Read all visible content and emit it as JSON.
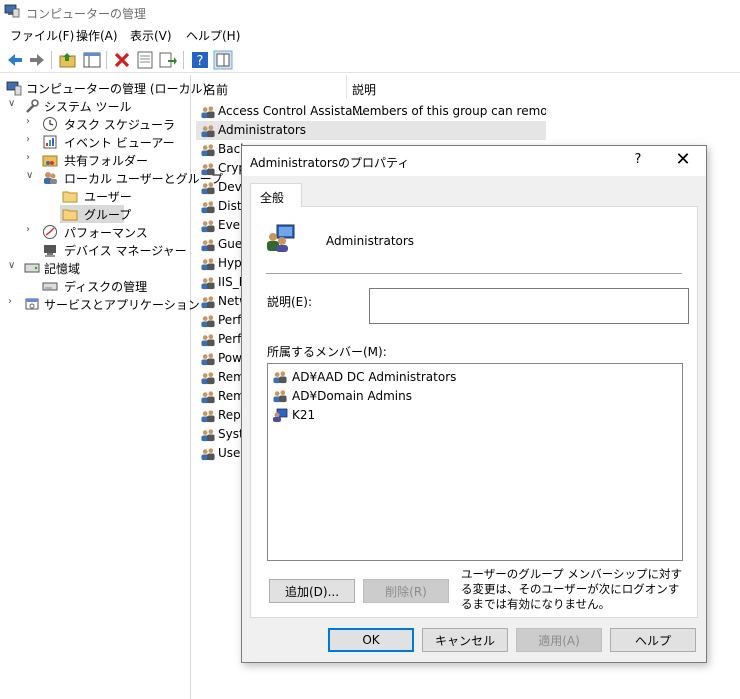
{
  "window": {
    "title": "コンピューターの管理"
  },
  "menu": [
    "ファイル(F)",
    "操作(A)",
    "表示(V)",
    "ヘルプ(H)"
  ],
  "toolbar": {
    "icons": [
      "back-icon",
      "forward-icon",
      "up-folder-icon",
      "show-tree-icon",
      "delete-icon",
      "properties-icon",
      "export-icon",
      "help-icon",
      "action-pane-icon"
    ]
  },
  "tree": {
    "root": "コンピューターの管理 (ローカル)",
    "system_tools": "システム ツール",
    "task_scheduler": "タスク スケジューラ",
    "event_viewer": "イベント ビューアー",
    "shared_folders": "共有フォルダー",
    "local_users_groups": "ローカル ユーザーとグループ",
    "users": "ユーザー",
    "groups": "グループ",
    "performance": "パフォーマンス",
    "device_manager": "デバイス マネージャー",
    "storage": "記憶域",
    "disk_management": "ディスクの管理",
    "services_apps": "サービスとアプリケーション"
  },
  "list": {
    "col_name": "名前",
    "col_desc": "説明",
    "rows": [
      {
        "name": "Access Control Assista...",
        "desc": "Members of this group can remot..."
      },
      {
        "name": "Administrators",
        "desc": ""
      },
      {
        "name": "Back",
        "desc": ""
      },
      {
        "name": "Cryp",
        "desc": ""
      },
      {
        "name": "Devi",
        "desc": ""
      },
      {
        "name": "Distr",
        "desc": ""
      },
      {
        "name": "Even",
        "desc": ""
      },
      {
        "name": "Gues",
        "desc": ""
      },
      {
        "name": "Hypo",
        "desc": ""
      },
      {
        "name": "IIS_IU",
        "desc": ""
      },
      {
        "name": "Netw",
        "desc": ""
      },
      {
        "name": "Perfo",
        "desc": ""
      },
      {
        "name": "Perfo",
        "desc": ""
      },
      {
        "name": "Powe",
        "desc": ""
      },
      {
        "name": "Rem",
        "desc": ""
      },
      {
        "name": "Rem",
        "desc": ""
      },
      {
        "name": "Repl",
        "desc": ""
      },
      {
        "name": "Syste",
        "desc": ""
      },
      {
        "name": "User",
        "desc": ""
      }
    ]
  },
  "dialog": {
    "title": "Administratorsのプロパティ",
    "help_glyph": "?",
    "close_glyph": "✕",
    "tab": "全般",
    "group_name": "Administrators",
    "description_label": "説明(E):",
    "description_value": "",
    "members_label": "所属するメンバー(M):",
    "members": [
      {
        "name": "AD¥AAD DC Administrators",
        "icon": "group-icon"
      },
      {
        "name": "AD¥Domain Admins",
        "icon": "group-icon"
      },
      {
        "name": "K21",
        "icon": "user-icon"
      }
    ],
    "add_button": "追加(D)...",
    "remove_button": "削除(R)",
    "note": "ユーザーのグループ メンバーシップに対する変更は、そのユーザーが次にログオンするまでは有効になりません。",
    "ok_button": "OK",
    "cancel_button": "キャンセル",
    "apply_button": "適用(A)",
    "help_button": "ヘルプ"
  },
  "colors": {
    "accent": "#0078d7",
    "selection": "#d9d9d9"
  }
}
